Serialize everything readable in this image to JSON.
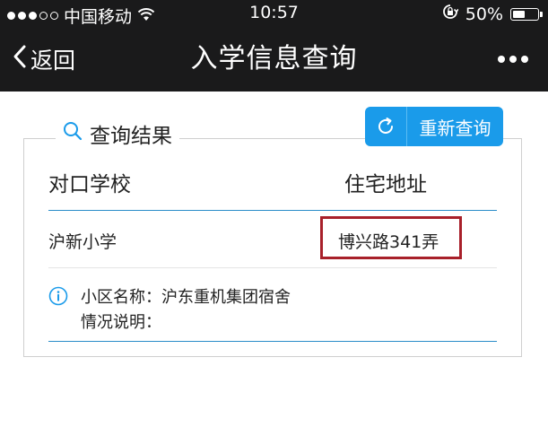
{
  "status_bar": {
    "carrier": "中国移动",
    "time": "10:57",
    "battery": "50%",
    "battery_level": 0.5,
    "signal_bars_filled": 3,
    "signal_bars_total": 5
  },
  "nav": {
    "back_label": "返回",
    "title": "入学信息查询"
  },
  "result": {
    "section_title": "查询结果",
    "requery_label": "重新查询",
    "columns": [
      "对口学校",
      "住宅地址"
    ],
    "rows": [
      {
        "school": "沪新小学",
        "address": "博兴路341弄"
      }
    ],
    "info": {
      "community": "小区名称：沪东重机集团宿舍",
      "notes": "情况说明："
    }
  },
  "colors": {
    "bar_bg": "#1a1a1b",
    "accent": "#1a9bea",
    "highlight": "#a8202a"
  }
}
